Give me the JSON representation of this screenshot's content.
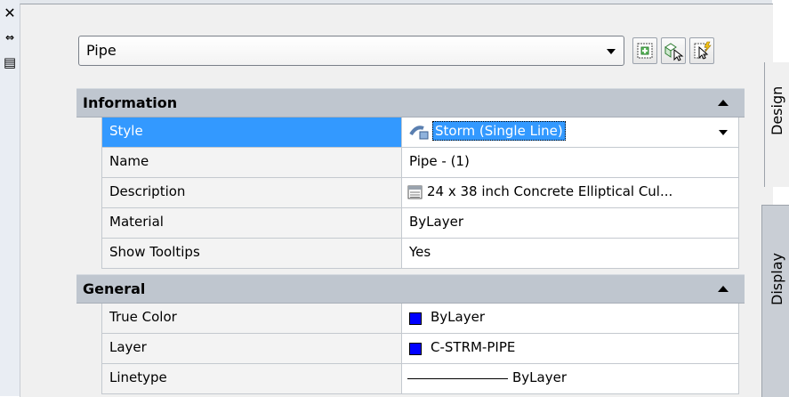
{
  "strip": {
    "close_glyph": "✕",
    "autohide_glyph": "⇔",
    "properties_glyph": "▤"
  },
  "object_select": {
    "value": "Pipe"
  },
  "toolbar": {
    "buttons": [
      "toggle-pickadd-icon",
      "select-objects-icon",
      "quick-select-icon"
    ]
  },
  "categories": [
    {
      "label": "Information",
      "rows": [
        {
          "name": "Style",
          "value": "Storm (Single Line)",
          "icon": "pipe-style-icon"
        },
        {
          "name": "Name",
          "value": "Pipe - (1)"
        },
        {
          "name": "Description",
          "value": "24 x 38 inch Concrete Elliptical Cul...",
          "icon": "table-icon"
        },
        {
          "name": "Material",
          "value": "ByLayer"
        },
        {
          "name": "Show Tooltips",
          "value": "Yes"
        }
      ]
    },
    {
      "label": "General",
      "rows": [
        {
          "name": "True Color",
          "value": "ByLayer",
          "swatch": "#0000ff"
        },
        {
          "name": "Layer",
          "value": "C-STRM-PIPE",
          "swatch": "#0000ff"
        },
        {
          "name": "Linetype",
          "value": "ByLayer"
        }
      ]
    }
  ],
  "tabs": {
    "design": "Design",
    "display": "Display"
  },
  "colors": {
    "selection": "#3399ff",
    "category_bg": "#bfc6cf",
    "swatch": "#0000ff"
  }
}
